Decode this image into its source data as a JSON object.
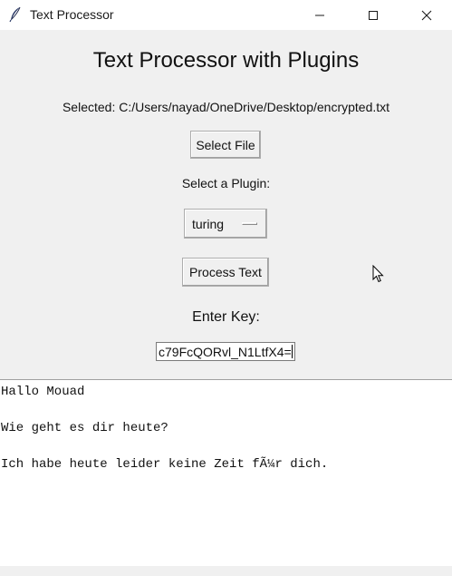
{
  "window": {
    "title": "Text Processor"
  },
  "heading": "Text Processor with Plugins",
  "selected_file_text": "Selected: C:/Users/nayad/OneDrive/Desktop/encrypted.txt",
  "buttons": {
    "select_file": "Select File",
    "process_text": "Process Text"
  },
  "plugin": {
    "label": "Select a Plugin:",
    "selected": "turing"
  },
  "key": {
    "label": "Enter Key:",
    "value": "c79FcQORvl_N1LtfX4="
  },
  "output": {
    "lines": [
      "Hallo Mouad",
      "Wie geht es dir heute?",
      "Ich habe heute leider keine Zeit fÃ¼r dich."
    ]
  },
  "icons": {
    "app": "feather-icon",
    "minimize": "minimize-icon",
    "maximize": "maximize-icon",
    "close": "close-icon",
    "cursor": "mouse-pointer-icon"
  }
}
